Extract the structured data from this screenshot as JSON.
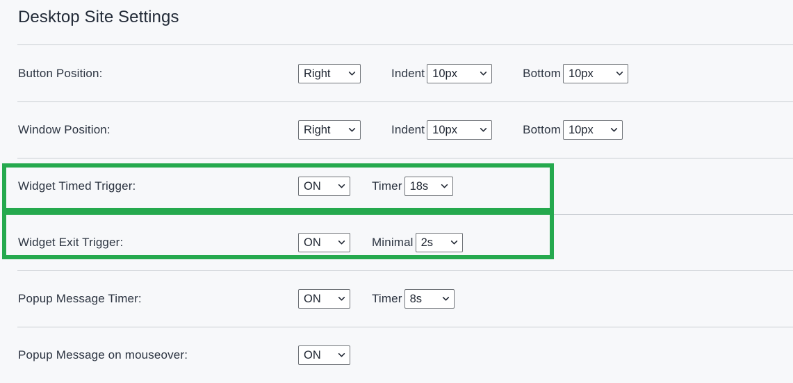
{
  "page": {
    "title": "Desktop Site Settings",
    "accent_green": "#25a94e",
    "background": "#f7f8fa",
    "divider_color": "#c9cdd2",
    "text_color": "#2b3340"
  },
  "rows": [
    {
      "label": "Button Position:",
      "controls": [
        {
          "kind": "select",
          "name": "button-position-select",
          "value": "Right"
        },
        {
          "kind": "label",
          "name": "indent-label",
          "text": "Indent"
        },
        {
          "kind": "select",
          "name": "button-indent-select",
          "value": "10px"
        },
        {
          "kind": "label",
          "name": "bottom-label",
          "text": "Bottom"
        },
        {
          "kind": "select",
          "name": "button-bottom-select",
          "value": "10px"
        }
      ]
    },
    {
      "label": "Window Position:",
      "controls": [
        {
          "kind": "select",
          "name": "window-position-select",
          "value": "Right"
        },
        {
          "kind": "label",
          "name": "indent-label",
          "text": "Indent"
        },
        {
          "kind": "select",
          "name": "window-indent-select",
          "value": "10px"
        },
        {
          "kind": "label",
          "name": "bottom-label",
          "text": "Bottom"
        },
        {
          "kind": "select",
          "name": "window-bottom-select",
          "value": "10px"
        }
      ]
    },
    {
      "label": "Widget Timed Trigger:",
      "highlighted": true,
      "controls": [
        {
          "kind": "select",
          "name": "widget-timed-trigger-toggle",
          "value": "ON"
        },
        {
          "kind": "label",
          "name": "timer-label",
          "text": "Timer"
        },
        {
          "kind": "select",
          "name": "widget-timed-trigger-timer-select",
          "value": "18s"
        }
      ]
    },
    {
      "label": "Widget Exit Trigger:",
      "highlighted": true,
      "controls": [
        {
          "kind": "select",
          "name": "widget-exit-trigger-toggle",
          "value": "ON"
        },
        {
          "kind": "label",
          "name": "minimal-label",
          "text": "Minimal"
        },
        {
          "kind": "select",
          "name": "widget-exit-trigger-minimal-select",
          "value": "2s"
        }
      ]
    },
    {
      "label": "Popup Message Timer:",
      "controls": [
        {
          "kind": "select",
          "name": "popup-message-timer-toggle",
          "value": "ON"
        },
        {
          "kind": "label",
          "name": "timer-label",
          "text": "Timer"
        },
        {
          "kind": "select",
          "name": "popup-message-timer-select",
          "value": "8s"
        }
      ]
    },
    {
      "label": "Popup Message on mouseover:",
      "controls": [
        {
          "kind": "select",
          "name": "popup-message-mouseover-toggle",
          "value": "ON"
        }
      ]
    }
  ],
  "icons": {
    "chevron": "chevron-down-icon"
  }
}
